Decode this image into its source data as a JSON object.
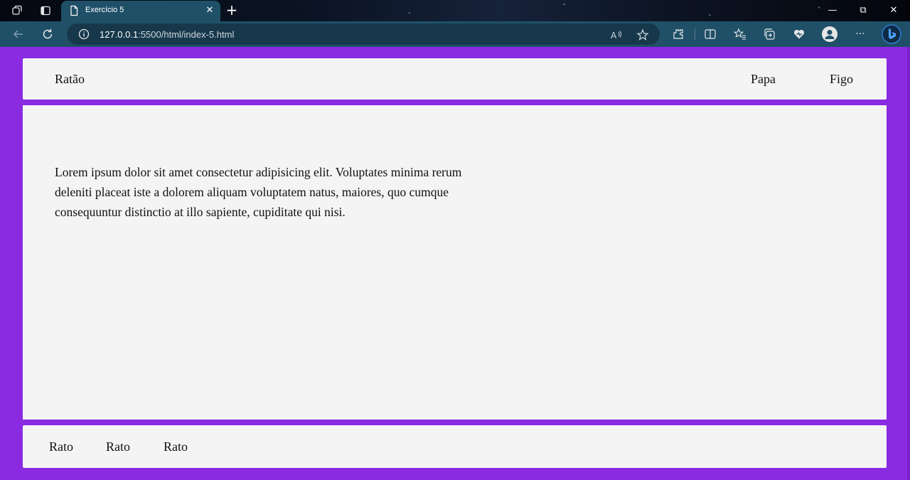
{
  "browser": {
    "tab_title": "Exercício 5",
    "tab_close": "✕",
    "new_tab": "+",
    "url_host": "127.0.0.1",
    "url_rest": ":5500/html/index-5.html",
    "window_controls": {
      "minimize": "—",
      "restore": "⧉",
      "close": "✕"
    },
    "menu": "···"
  },
  "header": {
    "brand": "Ratão",
    "nav": [
      "Papa",
      "Figo"
    ]
  },
  "main": {
    "paragraph": "Lorem ipsum dolor sit amet consectetur adipisicing elit. Voluptates minima rerum deleniti placeat iste a dolorem aliquam voluptatem natus, maiores, quo cumque consequuntur distinctio at illo sapiente, cupiditate qui nisi."
  },
  "footer": {
    "links": [
      "Rato",
      "Rato",
      "Rato"
    ]
  },
  "colors": {
    "page_background": "#8a2be2",
    "panel_background": "#f4f4f5",
    "browser_toolbar": "#1f5068"
  }
}
